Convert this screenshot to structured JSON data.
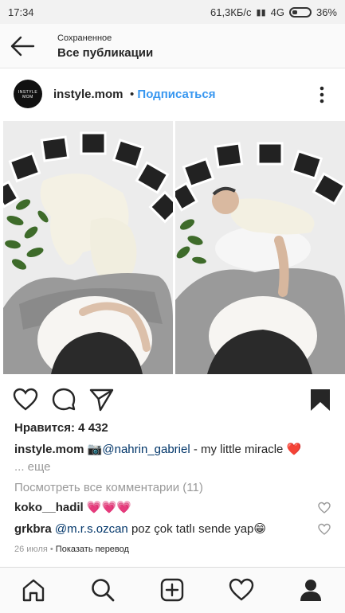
{
  "status": {
    "time": "17:34",
    "speed": "61,3КБ/с",
    "network": "4G",
    "battery": "36%"
  },
  "appbar": {
    "subtitle": "Сохраненное",
    "title": "Все публикации"
  },
  "post": {
    "avatar_text": "INSTYLE MOM",
    "username": "instyle.mom",
    "separator": " • ",
    "follow_label": "Подписаться",
    "likes": "Нравится: 4 432",
    "caption": {
      "user": "instyle.mom",
      "emoji": "📷",
      "mention": "@nahrin_gabriel",
      "text": " - my little miracle ❤️",
      "more": "... еще"
    },
    "view_comments": "Посмотреть все комментарии (11)",
    "comments": [
      {
        "user": "koko__hadil",
        "mention": "",
        "text": " 💗💗💗"
      },
      {
        "user": "grkbra",
        "mention": " @m.r.s.ozcan",
        "text": "  poz çok tatlı sende yap😁"
      }
    ],
    "date": "26 июля",
    "translate": "Показать перевод"
  },
  "colors": {
    "link": "#3897f0",
    "mention": "#003569",
    "muted": "#999999"
  }
}
